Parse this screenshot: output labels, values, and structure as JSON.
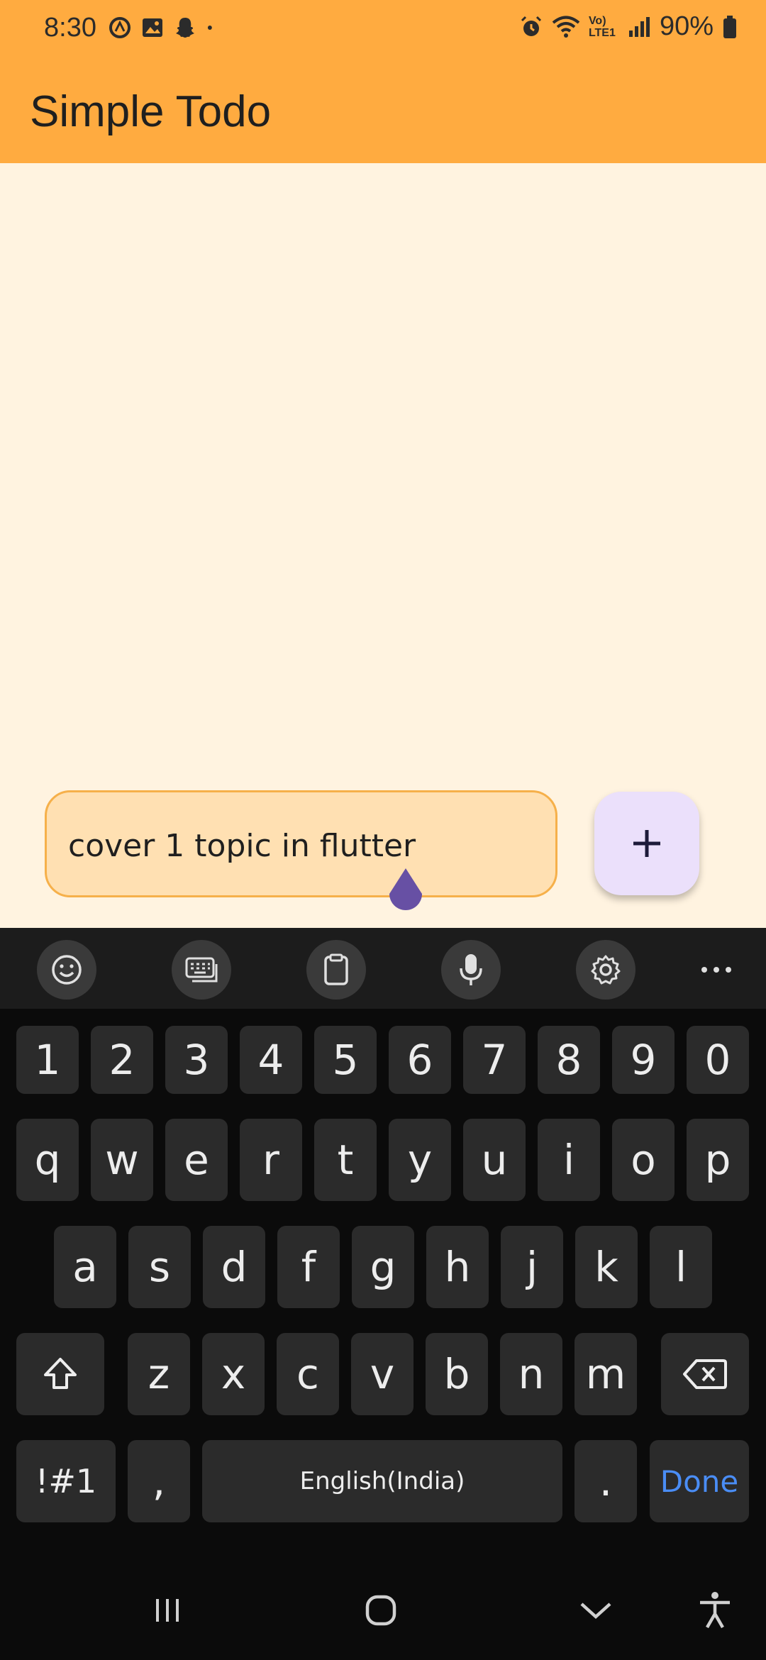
{
  "status_bar": {
    "time": "8:30",
    "left_icons": [
      "sync-icon",
      "gallery-icon",
      "snapchat-icon",
      "dot-icon"
    ],
    "right_icons": [
      "alarm-icon",
      "wifi-icon",
      "volte-icon",
      "signal-icon"
    ],
    "volte_label": "Vo) LTE1",
    "battery_percent": "90%"
  },
  "app_bar": {
    "title": "Simple Todo"
  },
  "todo_input": {
    "value": "cover 1 topic in flutter"
  },
  "fab": {
    "icon": "plus-icon",
    "color": "#ebe0fb"
  },
  "keyboard": {
    "toolbar": [
      "emoji-icon",
      "keyboard-icon",
      "clipboard-icon",
      "mic-icon",
      "settings-icon",
      "more-icon"
    ],
    "number_row": [
      "1",
      "2",
      "3",
      "4",
      "5",
      "6",
      "7",
      "8",
      "9",
      "0"
    ],
    "row1": [
      "q",
      "w",
      "e",
      "r",
      "t",
      "y",
      "u",
      "i",
      "o",
      "p"
    ],
    "row2": [
      "a",
      "s",
      "d",
      "f",
      "g",
      "h",
      "j",
      "k",
      "l"
    ],
    "row3": [
      "z",
      "x",
      "c",
      "v",
      "b",
      "n",
      "m"
    ],
    "bottom": {
      "symbols": "!#1",
      "comma": ",",
      "space": "English(India)",
      "period": ".",
      "done": "Done"
    }
  },
  "nav_bar": {
    "icons": [
      "recents-icon",
      "home-icon",
      "hide-keyboard-icon",
      "accessibility-icon"
    ]
  },
  "colors": {
    "app_bar": "#ffab40",
    "background": "#fff3e0",
    "input_fill": "#ffe0b2",
    "cursor_handle": "#6750a4",
    "done_text": "#4a8df5"
  }
}
